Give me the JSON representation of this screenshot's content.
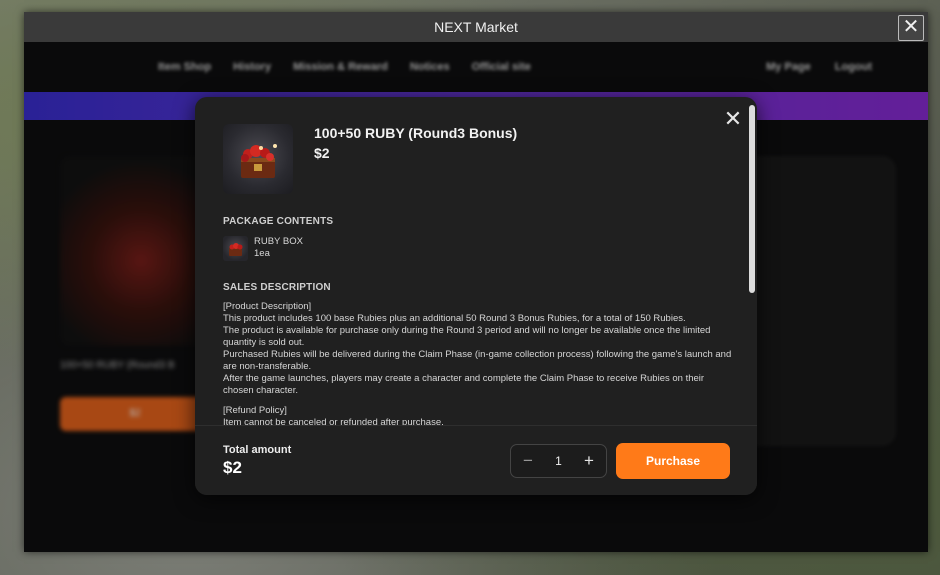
{
  "window": {
    "title": "NEXT Market",
    "close_label": "✕"
  },
  "nav": {
    "items": [
      "Item Shop",
      "History",
      "Mission & Reward",
      "Notices",
      "Official site"
    ],
    "right_items": [
      "My Page",
      "Logout"
    ]
  },
  "background_card": {
    "name": "100+50 RUBY (Round3 B",
    "button_label": "$2"
  },
  "modal": {
    "close_label": "✕",
    "product": {
      "title": "100+50 RUBY (Round3 Bonus)",
      "price": "$2"
    },
    "package_contents": {
      "heading": "PACKAGE CONTENTS",
      "items": [
        {
          "name": "RUBY BOX",
          "quantity": "1ea"
        }
      ]
    },
    "sales_description": {
      "heading": "SALES DESCRIPTION",
      "lines": [
        "[Product Description]",
        "This product includes 100 base Rubies plus an additional 50 Round 3 Bonus Rubies, for a total of 150 Rubies.",
        "The product is available for purchase only during the Round 3 period and will no longer be available once the limited quantity is sold out.",
        "Purchased Rubies will be delivered during the Claim Phase (in-game collection process) following the game's launch and are non-transferable.",
        "After the game launches, players may create a character and complete the Claim Phase to receive Rubies on their chosen character.",
        "",
        "[Refund Policy]",
        "Item cannot be canceled or refunded after purchase."
      ]
    },
    "footer": {
      "total_label": "Total amount",
      "total_value": "$2",
      "quantity": "1",
      "minus_label": "−",
      "plus_label": "+",
      "purchase_label": "Purchase"
    }
  },
  "colors": {
    "accent": "#ff7a18",
    "banner_start": "#3a2fd0",
    "banner_end": "#8a2bd4",
    "modal_bg": "#202020"
  }
}
